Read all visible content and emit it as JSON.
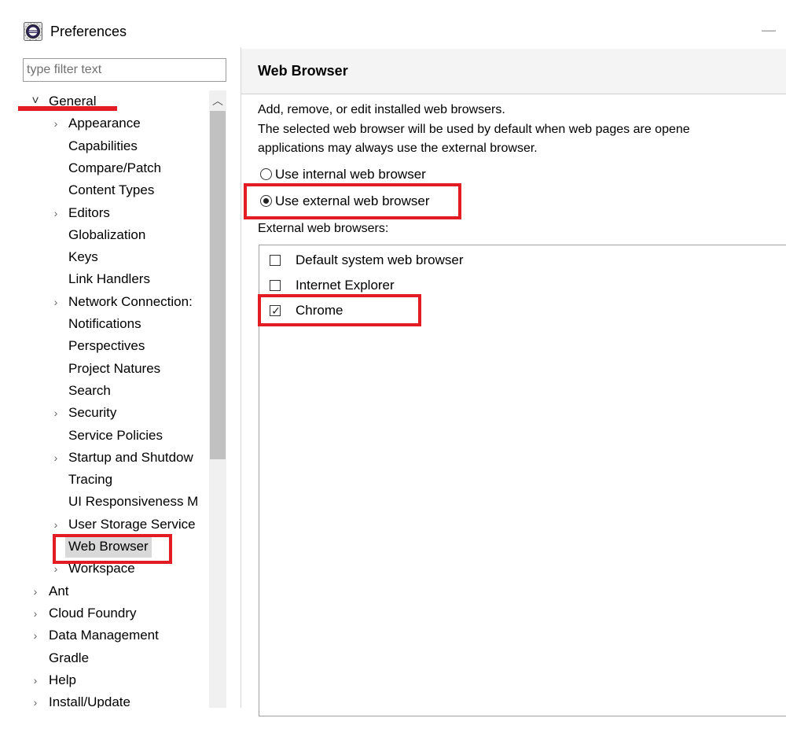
{
  "window": {
    "title": "Preferences",
    "minimize_glyph": "—",
    "app_icon": "eclipse-icon"
  },
  "filter": {
    "placeholder": "type filter text"
  },
  "tree": {
    "items": [
      {
        "label": "General",
        "level": 0,
        "expandable": true,
        "expanded": true
      },
      {
        "label": "Appearance",
        "level": 1,
        "expandable": true
      },
      {
        "label": "Capabilities",
        "level": 1,
        "expandable": false
      },
      {
        "label": "Compare/Patch",
        "level": 1,
        "expandable": false
      },
      {
        "label": "Content Types",
        "level": 1,
        "expandable": false
      },
      {
        "label": "Editors",
        "level": 1,
        "expandable": true
      },
      {
        "label": "Globalization",
        "level": 1,
        "expandable": false
      },
      {
        "label": "Keys",
        "level": 1,
        "expandable": false
      },
      {
        "label": "Link Handlers",
        "level": 1,
        "expandable": false
      },
      {
        "label": "Network Connection:",
        "level": 1,
        "expandable": true
      },
      {
        "label": "Notifications",
        "level": 1,
        "expandable": false
      },
      {
        "label": "Perspectives",
        "level": 1,
        "expandable": false
      },
      {
        "label": "Project Natures",
        "level": 1,
        "expandable": false
      },
      {
        "label": "Search",
        "level": 1,
        "expandable": false
      },
      {
        "label": "Security",
        "level": 1,
        "expandable": true
      },
      {
        "label": "Service Policies",
        "level": 1,
        "expandable": false
      },
      {
        "label": "Startup and Shutdow",
        "level": 1,
        "expandable": true
      },
      {
        "label": "Tracing",
        "level": 1,
        "expandable": false
      },
      {
        "label": "UI Responsiveness M",
        "level": 1,
        "expandable": false
      },
      {
        "label": "User Storage Service",
        "level": 1,
        "expandable": true
      },
      {
        "label": "Web Browser",
        "level": 1,
        "expandable": false,
        "selected": true
      },
      {
        "label": "Workspace",
        "level": 1,
        "expandable": true
      },
      {
        "label": "Ant",
        "level": 0,
        "expandable": true
      },
      {
        "label": "Cloud Foundry",
        "level": 0,
        "expandable": true
      },
      {
        "label": "Data Management",
        "level": 0,
        "expandable": true
      },
      {
        "label": "Gradle",
        "level": 0,
        "expandable": false
      },
      {
        "label": "Help",
        "level": 0,
        "expandable": true
      },
      {
        "label": "Install/Update",
        "level": 0,
        "expandable": true
      }
    ]
  },
  "page": {
    "title": "Web Browser",
    "description": [
      "Add, remove, or edit installed web browsers.",
      "The selected web browser will be used by default when web pages are opene",
      "applications may always use the external browser."
    ],
    "radio_internal": "Use internal web browser",
    "radio_external": "Use external web browser",
    "selected_mode": "external",
    "browsers_label": "External web browsers:",
    "browsers": [
      {
        "label": "Default system web browser",
        "checked": false
      },
      {
        "label": "Internet Explorer",
        "checked": false
      },
      {
        "label": "Chrome",
        "checked": true
      }
    ]
  },
  "colors": {
    "annotation_red": "#e31b23",
    "selection_gray": "#d9d9d9",
    "header_bg": "#f4f4f4"
  }
}
